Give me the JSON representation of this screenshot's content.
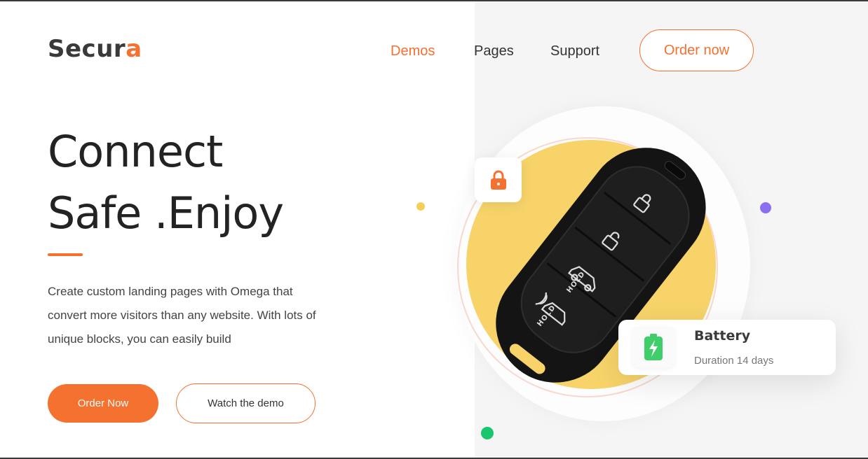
{
  "brand": {
    "logo_main": "Secur",
    "logo_accent": "a"
  },
  "nav": {
    "items": [
      {
        "label": "Demos",
        "active": true
      },
      {
        "label": "Pages",
        "active": false
      },
      {
        "label": "Support",
        "active": false
      }
    ],
    "order_button": "Order now"
  },
  "hero": {
    "line1": "Connect",
    "line2": "Safe .Enjoy",
    "description": "Create custom landing pages with Omega that convert more visitors than any website. With lots of unique blocks, you can easily build"
  },
  "actions": {
    "primary": "Order Now",
    "secondary": "Watch the demo"
  },
  "key_fob": {
    "buttons": [
      {
        "icon": "lock-icon"
      },
      {
        "icon": "unlock-icon"
      },
      {
        "icon": "trunk-icon",
        "label": "HOLD"
      },
      {
        "icon": "panic-icon",
        "label": "HOLD"
      }
    ]
  },
  "battery_card": {
    "title": "Battery",
    "subtitle": "Duration 14 days",
    "icon": "battery-charging-icon"
  },
  "colors": {
    "accent": "#f47130",
    "yellow": "#f7d36a",
    "purple": "#8c6ff0",
    "green": "#19c66e",
    "battery": "#3fcf6a"
  }
}
